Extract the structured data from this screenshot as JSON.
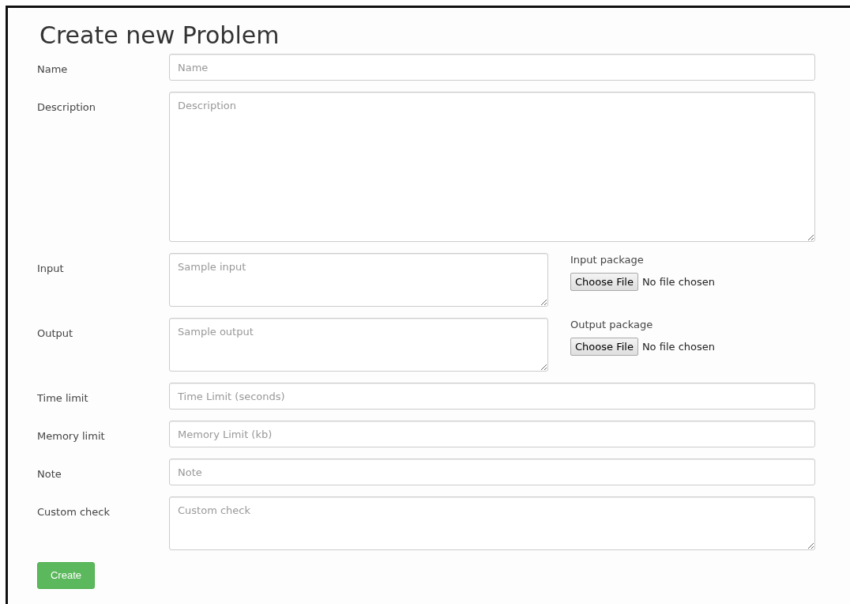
{
  "title": "Create new Problem",
  "fields": [
    {
      "label": "Name",
      "kind": "input",
      "placeholder": "Name"
    },
    {
      "label": "Description",
      "kind": "big-textarea",
      "placeholder": "Description"
    },
    {
      "label": "Input",
      "kind": "textarea-file",
      "placeholder": "Sample input",
      "file": {
        "label": "Input package",
        "button": "Choose File",
        "status": "No file chosen"
      }
    },
    {
      "label": "Output",
      "kind": "textarea-file",
      "placeholder": "Sample output",
      "file": {
        "label": "Output package",
        "button": "Choose File",
        "status": "No file chosen"
      }
    },
    {
      "label": "Time limit",
      "kind": "input",
      "placeholder": "Time Limit (seconds)"
    },
    {
      "label": "Memory limit",
      "kind": "input",
      "placeholder": "Memory Limit (kb)"
    },
    {
      "label": "Note",
      "kind": "input",
      "placeholder": "Note"
    },
    {
      "label": "Custom check",
      "kind": "textarea",
      "placeholder": "Custom check"
    }
  ],
  "submit": "Create"
}
